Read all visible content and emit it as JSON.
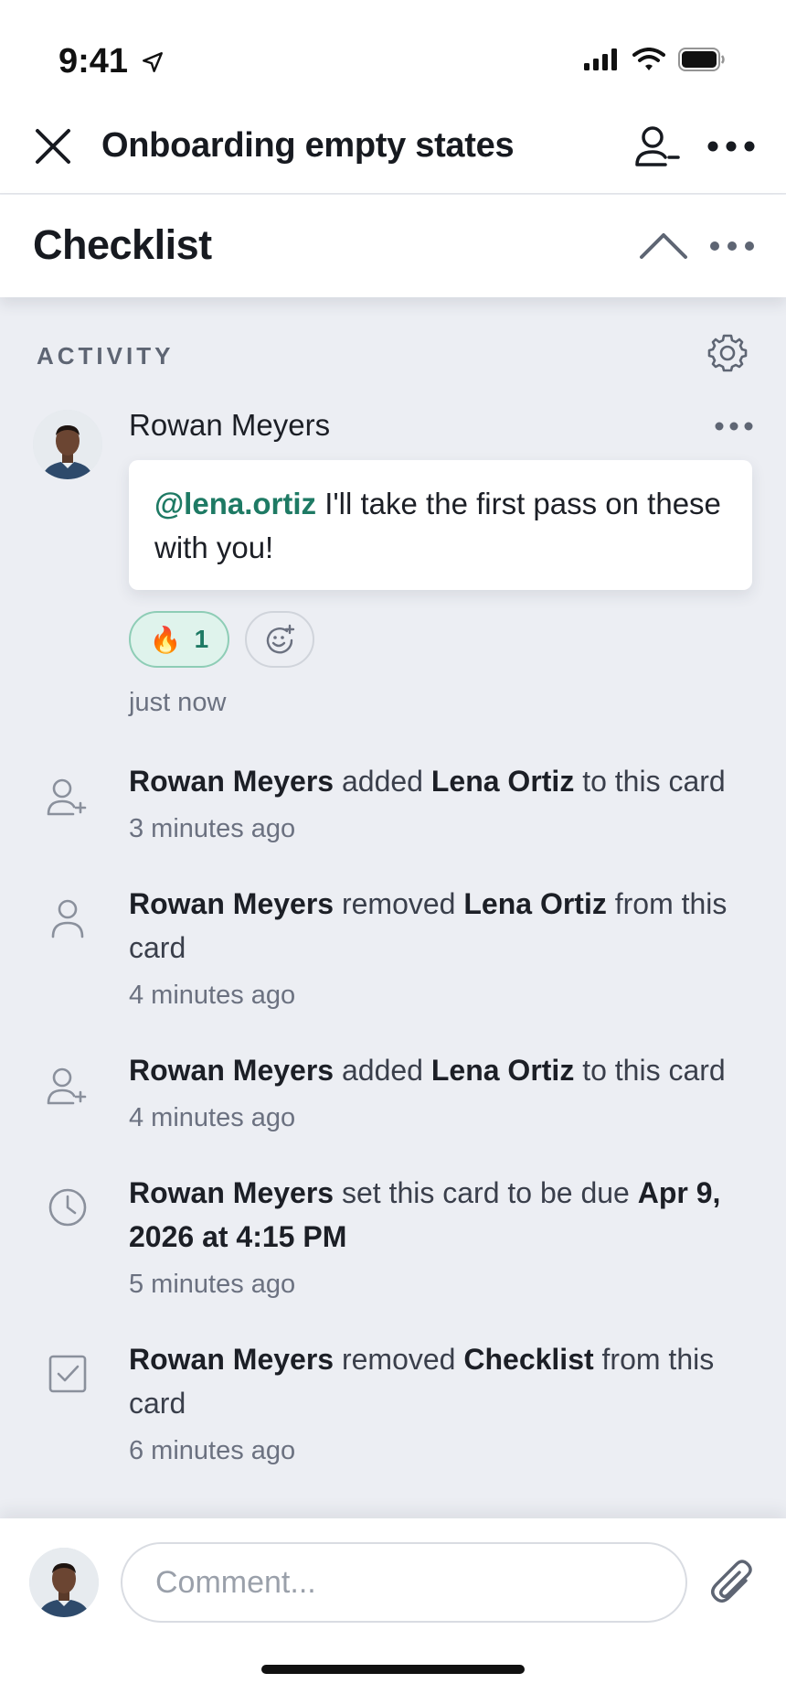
{
  "status_bar": {
    "time": "9:41"
  },
  "card": {
    "title": "Onboarding empty states"
  },
  "section": {
    "title": "Checklist"
  },
  "activity": {
    "label": "ACTIVITY",
    "comment": {
      "author": "Rowan Meyers",
      "mention": "@lena.ortiz",
      "text": " I'll take the first pass on these with you!",
      "reaction_emoji": "🔥",
      "reaction_count": "1",
      "time": "just now"
    },
    "items": [
      {
        "icon": "add-person-icon",
        "actor": "Rowan Meyers",
        "verb1": " added ",
        "object": "Lena Ortiz",
        "verb2": " to this card",
        "time": "3 minutes ago"
      },
      {
        "icon": "person-icon",
        "actor": "Rowan Meyers",
        "verb1": " removed ",
        "object": "Lena Ortiz",
        "verb2": " from this card",
        "time": "4 minutes ago"
      },
      {
        "icon": "add-person-icon",
        "actor": "Rowan Meyers",
        "verb1": " added ",
        "object": "Lena Ortiz",
        "verb2": " to this card",
        "time": "4 minutes ago"
      },
      {
        "icon": "clock-icon",
        "actor": "Rowan Meyers",
        "verb1": " set this card to be due ",
        "object": "Apr 9, 2026 at 4:15 PM",
        "verb2": "",
        "time": "5 minutes ago"
      },
      {
        "icon": "checkbox-icon",
        "actor": "Rowan Meyers",
        "verb1": " removed ",
        "object": "Checklist",
        "verb2": " from this card",
        "time": "6 minutes ago"
      }
    ]
  },
  "composer": {
    "placeholder": "Comment..."
  },
  "colors": {
    "accent": "#1E7A64",
    "background": "#ECEEF3"
  }
}
